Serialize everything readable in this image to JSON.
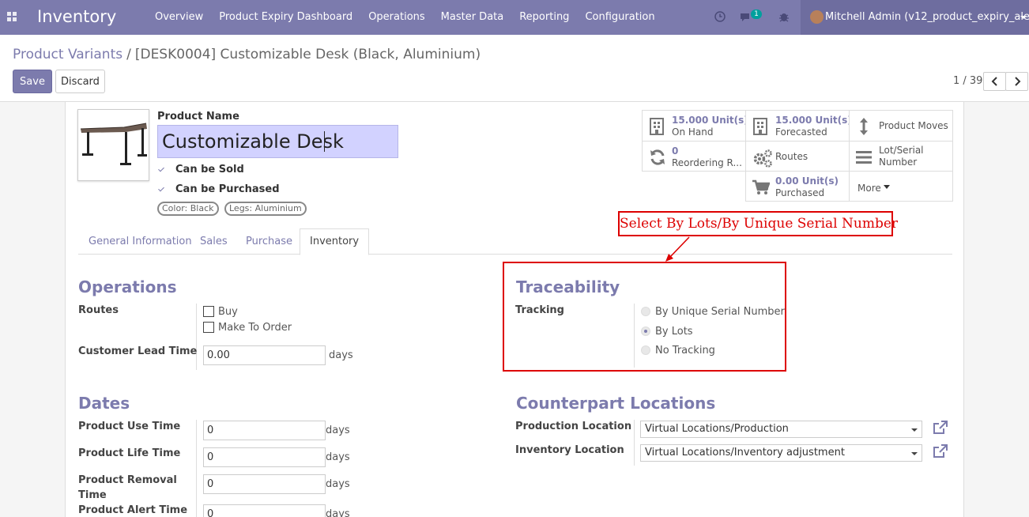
{
  "navbar": {
    "app_name": "Inventory",
    "menu": [
      "Overview",
      "Product Expiry Dashboard",
      "Operations",
      "Master Data",
      "Reporting",
      "Configuration"
    ],
    "message_count": "1",
    "user": "Mitchell Admin (v12_product_expiry_alert)",
    "icons": [
      "apps-grid-icon",
      "clock-icon",
      "chat-icon",
      "bug-icon"
    ]
  },
  "breadcrumb": {
    "parent": "Product Variants",
    "separator": "/",
    "current": "[DESK0004] Customizable Desk (Black, Aluminium)"
  },
  "buttons": {
    "save": "Save",
    "discard": "Discard"
  },
  "pager": {
    "text": "1 / 39"
  },
  "product": {
    "name_label": "Product Name",
    "name": "Customizable Desk",
    "can_be_sold": "Can be Sold",
    "can_be_purchased": "Can be Purchased",
    "tags": [
      "Color: Black",
      "Legs: Aluminium"
    ]
  },
  "smart_buttons": {
    "on_hand_value": "15.000 Unit(s)",
    "on_hand_label": "On Hand",
    "forecasted_value": "15.000 Unit(s)",
    "forecasted_label": "Forecasted",
    "product_moves": "Product Moves",
    "reordering_value": "0",
    "reordering_label": "Reordering R...",
    "routes": "Routes",
    "lot_serial_1": "Lot/Serial",
    "lot_serial_2": "Number",
    "purchased_value": "0.00 Unit(s)",
    "purchased_label": "Purchased",
    "more": "More"
  },
  "tabs": [
    "General Information",
    "Sales",
    "Purchase",
    "Inventory"
  ],
  "annotation": "Select By Lots/By Unique Serial Number",
  "operations": {
    "title": "Operations",
    "routes_label": "Routes",
    "route_buy": "Buy",
    "route_mto": "Make To Order",
    "lead_time_label": "Customer Lead Time",
    "lead_time_value": "0.00",
    "unit": "days"
  },
  "traceability": {
    "title": "Traceability",
    "tracking_label": "Tracking",
    "options": [
      "By Unique Serial Number",
      "By Lots",
      "No Tracking"
    ],
    "selected": "By Lots"
  },
  "dates": {
    "title": "Dates",
    "use_time_label": "Product Use Time",
    "use_time": "0",
    "life_time_label": "Product Life Time",
    "life_time": "0",
    "removal_time_label_1": "Product Removal",
    "removal_time_label_2": "Time",
    "removal_time": "0",
    "alert_time_label": "Product Alert Time",
    "alert_time": "0",
    "unit": "days"
  },
  "counterpart": {
    "title": "Counterpart Locations",
    "production_label": "Production Location",
    "production_value": "Virtual Locations/Production",
    "inventory_label": "Inventory Location",
    "inventory_value": "Virtual Locations/Inventory adjustment"
  },
  "colors": {
    "brand": "#7c7bad",
    "annotation": "#dd0000",
    "input_highlight": "#d2d2ff"
  }
}
